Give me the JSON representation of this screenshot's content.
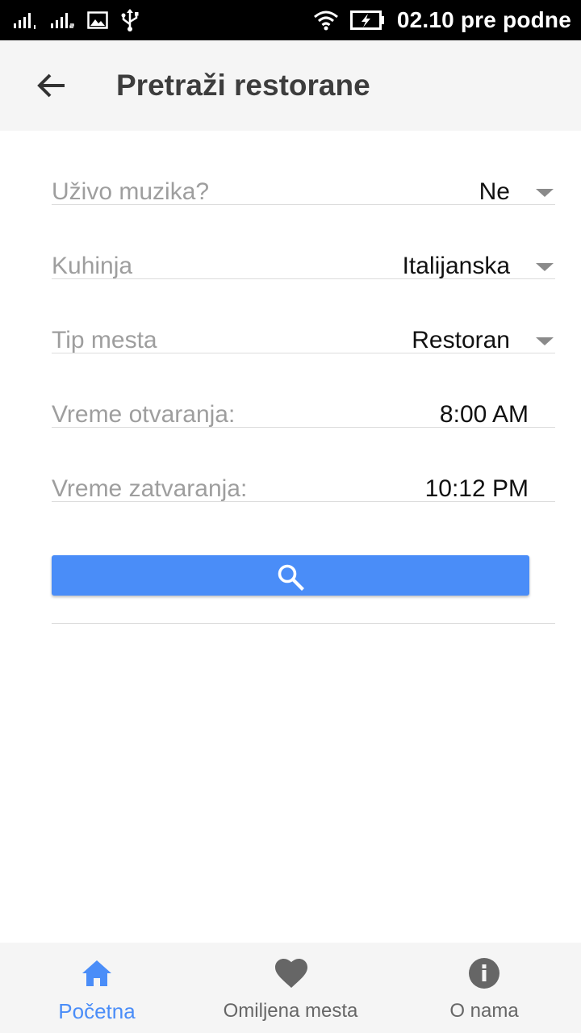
{
  "status_bar": {
    "time": "02.10 pre podne",
    "left_icons": [
      "signal-sim1-icon",
      "signal-sim2-icon",
      "image-icon",
      "usb-icon"
    ],
    "right_icons": [
      "wifi-icon",
      "battery-charging-icon"
    ]
  },
  "app_bar": {
    "title": "Pretraži restorane",
    "back_icon": "arrow-back-icon"
  },
  "form": {
    "rows": [
      {
        "label": "Uživo muzika?",
        "value": "Ne",
        "type": "dropdown"
      },
      {
        "label": "Kuhinja",
        "value": "Italijanska",
        "type": "dropdown"
      },
      {
        "label": "Tip mesta",
        "value": "Restoran",
        "type": "dropdown"
      },
      {
        "label": "Vreme otvaranja:",
        "value": "8:00 AM",
        "type": "time"
      },
      {
        "label": "Vreme zatvaranja:",
        "value": "10:12 PM",
        "type": "time"
      }
    ],
    "search_button_icon": "search-icon"
  },
  "bottom_nav": {
    "items": [
      {
        "label": "Početna",
        "icon": "home-icon",
        "active": true
      },
      {
        "label": "Omiljena mesta",
        "icon": "heart-icon",
        "active": false
      },
      {
        "label": "O nama",
        "icon": "info-icon",
        "active": false
      }
    ]
  },
  "colors": {
    "accent": "#4a8df8",
    "app_bar_bg": "#f5f5f5",
    "label_text": "#9e9e9e",
    "value_text": "#111111",
    "divider": "#dcdcdc",
    "inactive_nav": "#666666"
  }
}
